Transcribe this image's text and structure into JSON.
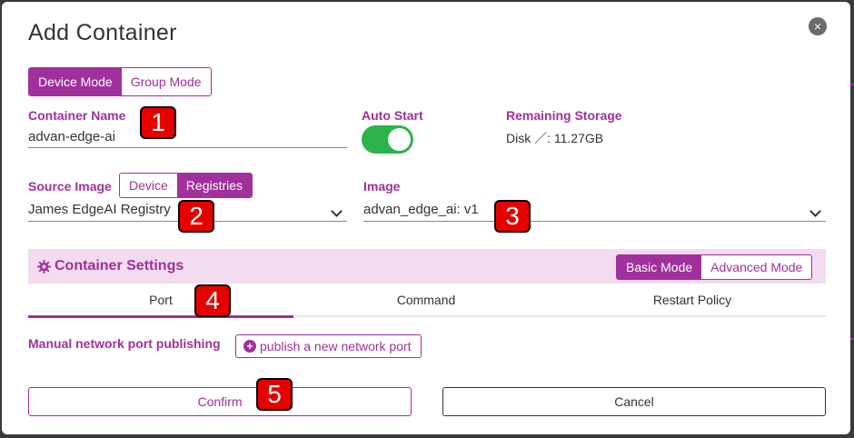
{
  "dialog": {
    "title": "Add Container",
    "close_glyph": "×"
  },
  "mode_toggle": {
    "device_mode": "Device Mode",
    "group_mode": "Group Mode",
    "selected": "Device Mode"
  },
  "container_name": {
    "label": "Container Name",
    "value": "advan-edge-ai"
  },
  "auto_start": {
    "label": "Auto Start",
    "on": true
  },
  "storage": {
    "label": "Remaining Storage",
    "value": "Disk ／:  11.27GB"
  },
  "source_image": {
    "label": "Source Image",
    "options": [
      "Device",
      "Registries"
    ],
    "selected": "Registries",
    "registry_value": "James EdgeAI Registry"
  },
  "image": {
    "label": "Image",
    "value": "advan_edge_ai: v1"
  },
  "settings": {
    "title": "Container Settings",
    "icon": "gear-icon",
    "basic_mode": "Basic Mode",
    "advanced_mode": "Advanced Mode",
    "selected": "Basic Mode",
    "tabs": [
      "Port",
      "Command",
      "Restart Policy"
    ],
    "active_tab": "Port"
  },
  "port": {
    "label": "Manual network port publishing",
    "publish_button": "publish a new network port",
    "plus_glyph": "+"
  },
  "actions": {
    "confirm": "Confirm",
    "cancel": "Cancel"
  },
  "annotations": [
    "1",
    "2",
    "3",
    "4",
    "5"
  ],
  "colors": {
    "accent": "#a0309b",
    "toggle_on": "#2db34a",
    "badge": "#e60000",
    "settings_bg": "#f3dbf0"
  }
}
